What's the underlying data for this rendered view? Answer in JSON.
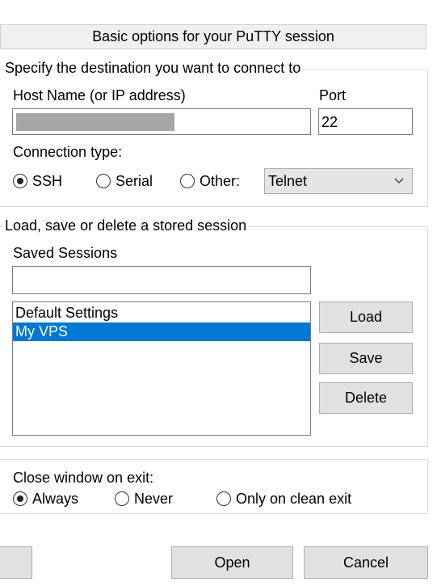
{
  "header": {
    "title": "Basic options for your PuTTY session"
  },
  "destination": {
    "group_title": "Specify the destination you want to connect to",
    "host_label": "Host Name (or IP address)",
    "host_value": "",
    "port_label": "Port",
    "port_value": "22",
    "conn_type_label": "Connection type:",
    "options": [
      {
        "label": "SSH",
        "checked": true
      },
      {
        "label": "Serial",
        "checked": false
      },
      {
        "label": "Other:",
        "checked": false
      }
    ],
    "other_select": {
      "value": "Telnet"
    }
  },
  "sessions": {
    "group_title": "Load, save or delete a stored session",
    "saved_label": "Saved Sessions",
    "saved_input_value": "",
    "list": [
      {
        "label": "Default Settings",
        "selected": false
      },
      {
        "label": "My VPS",
        "selected": true
      }
    ],
    "buttons": {
      "load": "Load",
      "save": "Save",
      "delete": "Delete"
    }
  },
  "exit": {
    "label": "Close window on exit:",
    "options": [
      {
        "label": "Always",
        "checked": true
      },
      {
        "label": "Never",
        "checked": false
      },
      {
        "label": "Only on clean exit",
        "checked": false
      }
    ]
  },
  "footer": {
    "open": "Open",
    "cancel": "Cancel",
    "left_button": ""
  },
  "colors": {
    "selection": "#0078d7",
    "button_face": "#e1e1e1"
  }
}
